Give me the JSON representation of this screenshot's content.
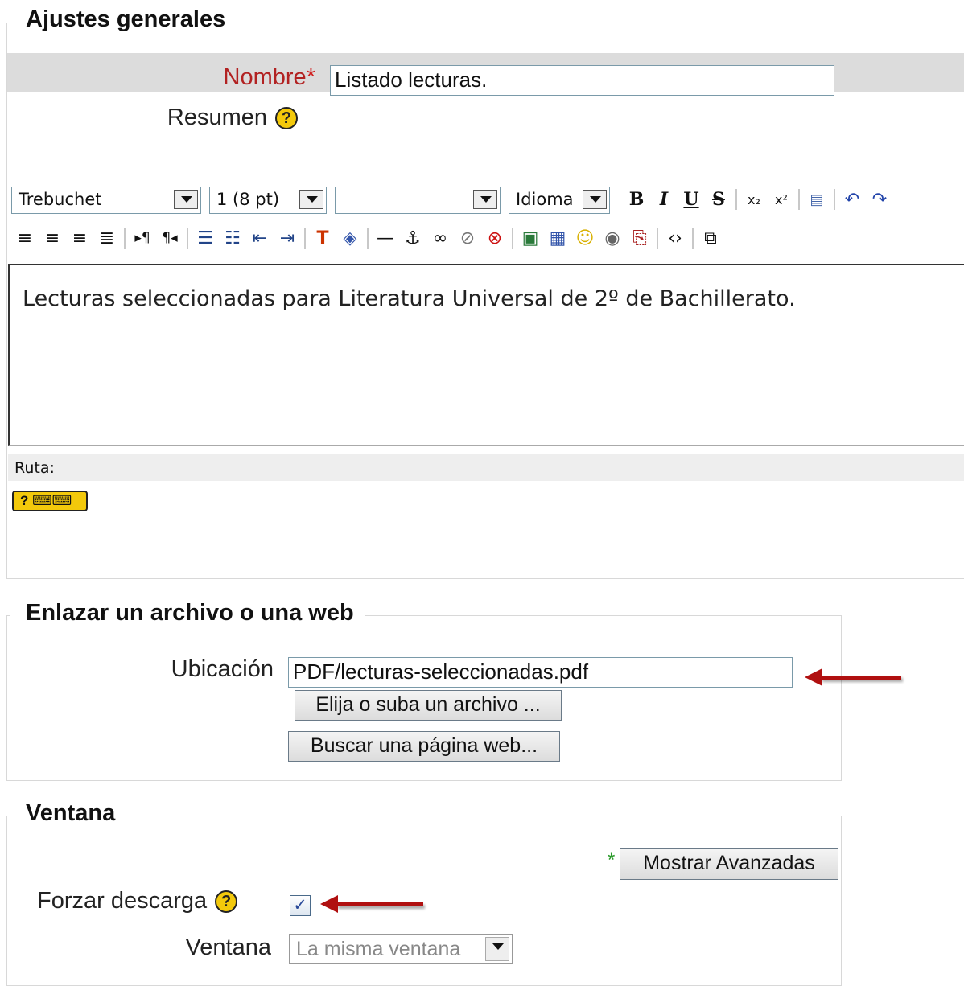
{
  "general": {
    "legend": "Ajustes generales",
    "name_label": "Nombre",
    "required_mark": "*",
    "name_value": "Listado lecturas.",
    "summary_label": "Resumen"
  },
  "editor": {
    "font_family": "Trebuchet",
    "font_size": "1 (8 pt)",
    "format": "",
    "language": "Idioma",
    "content": "Lecturas seleccionadas para Literatura Universal de 2º de Bachillerato.",
    "path_label": "Ruta:"
  },
  "link": {
    "legend": "Enlazar un archivo o una web",
    "location_label": "Ubicación",
    "location_value": "PDF/lecturas-seleccionadas.pdf",
    "choose_button": "Elija o suba un archivo ...",
    "search_button": "Buscar una página web..."
  },
  "window": {
    "legend": "Ventana",
    "advanced_mark": "*",
    "advanced_button": "Mostrar Avanzadas",
    "force_download_label": "Forzar descarga",
    "force_download_checked": true,
    "window_label": "Ventana",
    "window_value": "La misma ventana"
  },
  "colors": {
    "required": "#b22222",
    "arrow": "#b01010",
    "help": "#f3c90b"
  }
}
